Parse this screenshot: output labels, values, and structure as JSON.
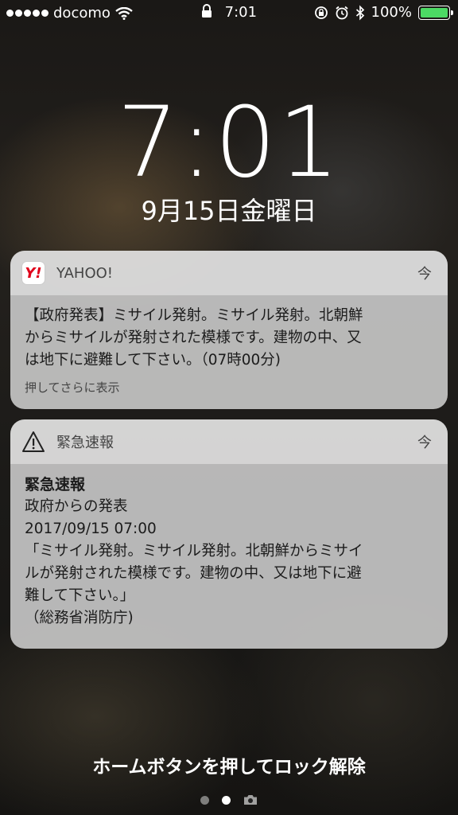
{
  "status_bar": {
    "carrier": "docomo",
    "time": "7:01",
    "battery": "100%",
    "battery_level": 1.0
  },
  "lock_screen": {
    "time": "7:01",
    "date": "9月15日金曜日"
  },
  "notifications": [
    {
      "app": "YAHOO!",
      "time": "今",
      "icon": "yahoo-icon",
      "lines": [
        "【政府発表】ミサイル発射。ミサイル発射。北朝鮮",
        "からミサイルが発射された模様です。建物の中、又",
        "は地下に避難して下さい。（07時00分)"
      ],
      "hint": "押してさらに表示"
    },
    {
      "app": "緊急速報",
      "time": "今",
      "icon": "warning-icon",
      "title": "緊急速報",
      "lines": [
        "政府からの発表",
        "2017/09/15 07:00",
        "「ミサイル発射。ミサイル発射。北朝鮮からミサイ",
        "ルが発射された模様です。建物の中、又は地下に避",
        "難して下さい。」",
        "（総務省消防庁)"
      ]
    }
  ],
  "unlock_text": "ホームボタンを押してロック解除",
  "colors": {
    "battery_fill": "#4cd964",
    "yahoo_red": "#e0001b"
  }
}
